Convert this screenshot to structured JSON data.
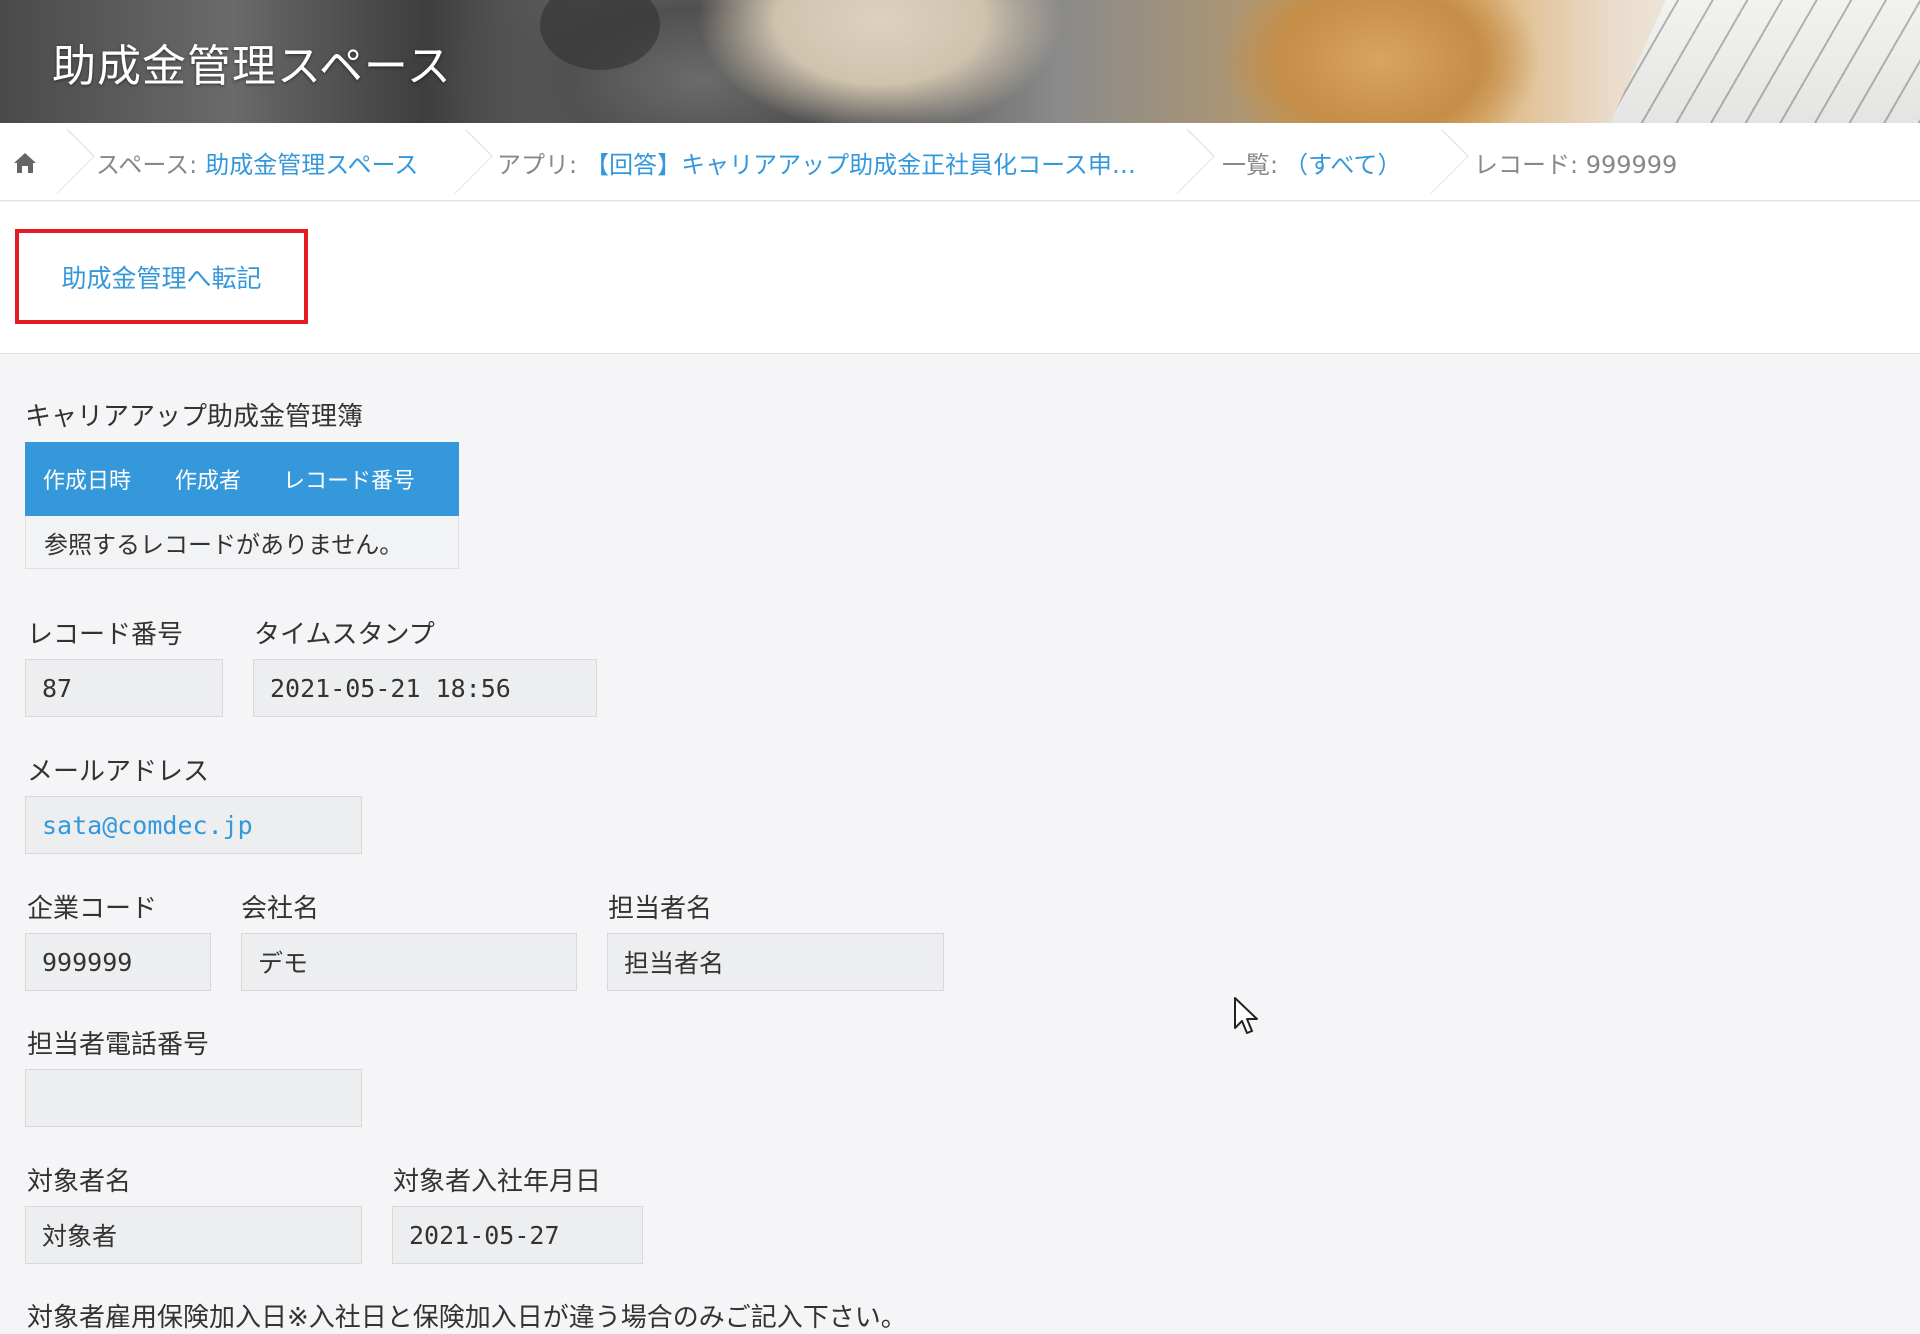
{
  "header": {
    "title": "助成金管理スペース"
  },
  "breadcrumb": {
    "space_label": "スペース:",
    "space_value": "助成金管理スペース",
    "app_label": "アプリ:",
    "app_value": "【回答】キャリアアップ助成金正社員化コース申…",
    "view_label": "一覧:",
    "view_value": "（すべて）",
    "record_label": "レコード: 999999"
  },
  "actions": {
    "transfer_button": "助成金管理へ転記"
  },
  "reference_table": {
    "title": "キャリアアップ助成金管理簿",
    "columns": [
      "作成日時",
      "作成者",
      "レコード番号"
    ],
    "empty_message": "参照するレコードがありません。"
  },
  "fields": {
    "record_number": {
      "label": "レコード番号",
      "value": "87"
    },
    "timestamp": {
      "label": "タイムスタンプ",
      "value": "2021-05-21 18:56"
    },
    "email": {
      "label": "メールアドレス",
      "value": "sata@comdec.jp"
    },
    "company_code": {
      "label": "企業コード",
      "value": "999999"
    },
    "company_name": {
      "label": "会社名",
      "value": "デモ"
    },
    "contact_name": {
      "label": "担当者名",
      "value": "担当者名"
    },
    "contact_phone": {
      "label": "担当者電話番号",
      "value": ""
    },
    "target_name": {
      "label": "対象者名",
      "value": "対象者"
    },
    "target_join_date": {
      "label": "対象者入社年月日",
      "value": "2021-05-27"
    },
    "insurance_note": {
      "label": "対象者雇用保険加入日※入社日と保険加入日が違う場合のみご記入下さい。"
    }
  },
  "colors": {
    "accent": "#3498db",
    "highlight_border": "#e31b23",
    "background": "#f5f5f7"
  },
  "icons": {
    "home": "home-icon",
    "cursor": "mouse-pointer-icon"
  }
}
